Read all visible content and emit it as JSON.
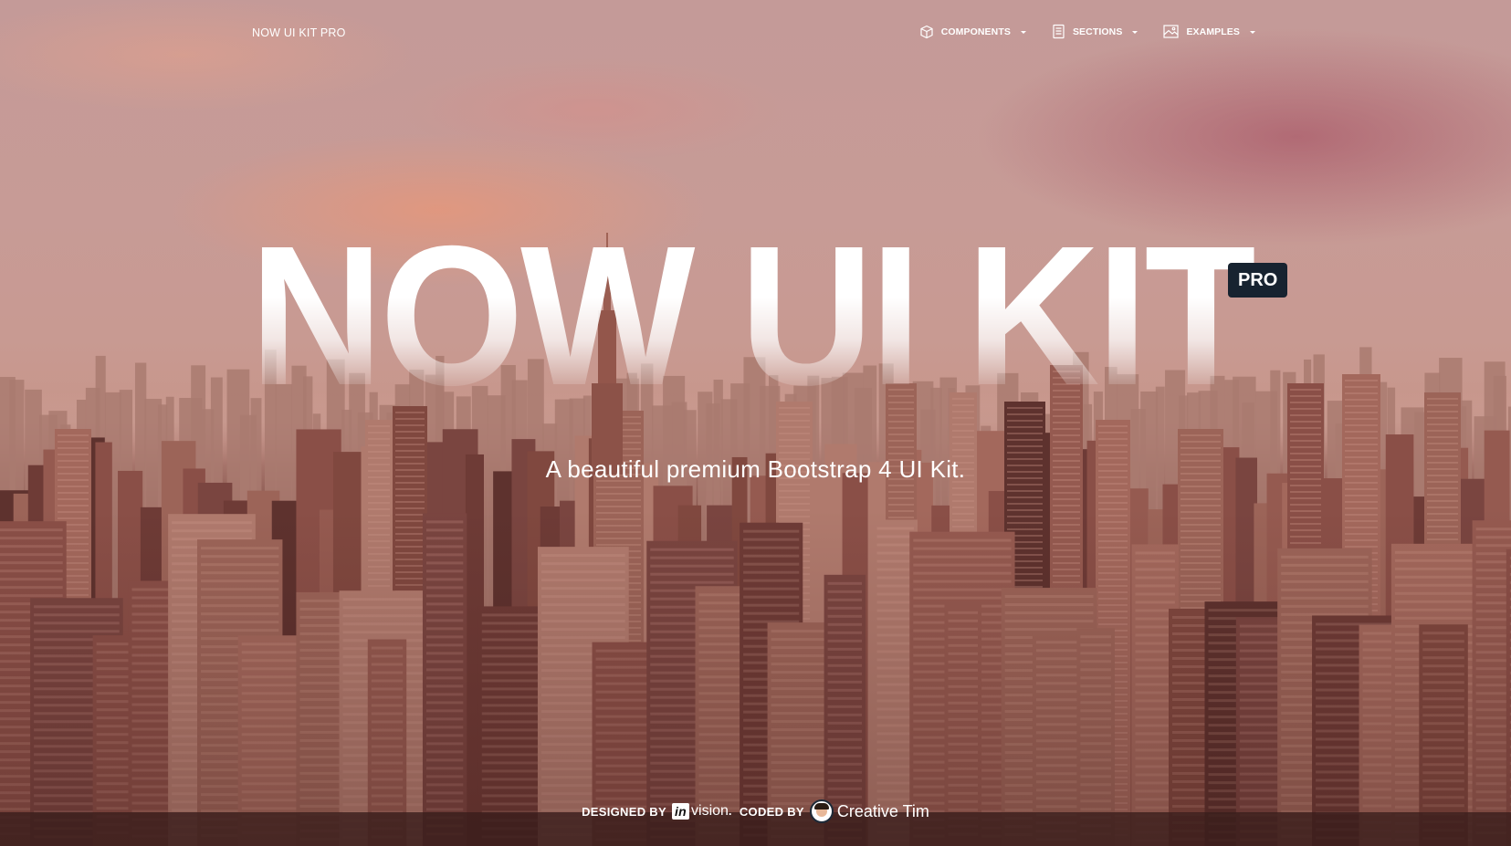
{
  "navbar": {
    "brand": "NOW UI KIT PRO",
    "items": [
      {
        "label": "COMPONENTS",
        "icon": "cube-icon"
      },
      {
        "label": "SECTIONS",
        "icon": "document-icon"
      },
      {
        "label": "EXAMPLES",
        "icon": "image-icon"
      }
    ]
  },
  "hero": {
    "title": "NOW UI KIT",
    "badge": "PRO",
    "subtitle": "A beautiful premium Bootstrap 4 UI Kit."
  },
  "credits": {
    "designed_by": "DESIGNED BY",
    "invision_in": "in",
    "invision_rest": "vision",
    "separator": ".",
    "coded_by": "CODED BY",
    "creative_tim": "Creative Tim"
  },
  "colors": {
    "badge_bg": "#172330",
    "sky_top": "#c49a98",
    "city_dark": "#6a3c37",
    "text": "#ffffff"
  }
}
